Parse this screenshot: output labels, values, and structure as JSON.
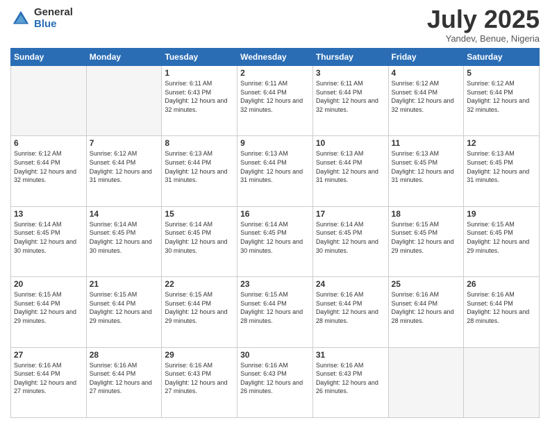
{
  "header": {
    "logo_general": "General",
    "logo_blue": "Blue",
    "title": "July 2025",
    "location": "Yandev, Benue, Nigeria"
  },
  "days_of_week": [
    "Sunday",
    "Monday",
    "Tuesday",
    "Wednesday",
    "Thursday",
    "Friday",
    "Saturday"
  ],
  "weeks": [
    [
      {
        "day": "",
        "empty": true
      },
      {
        "day": "",
        "empty": true
      },
      {
        "day": "1",
        "sunrise": "6:11 AM",
        "sunset": "6:43 PM",
        "daylight": "12 hours and 32 minutes."
      },
      {
        "day": "2",
        "sunrise": "6:11 AM",
        "sunset": "6:44 PM",
        "daylight": "12 hours and 32 minutes."
      },
      {
        "day": "3",
        "sunrise": "6:11 AM",
        "sunset": "6:44 PM",
        "daylight": "12 hours and 32 minutes."
      },
      {
        "day": "4",
        "sunrise": "6:12 AM",
        "sunset": "6:44 PM",
        "daylight": "12 hours and 32 minutes."
      },
      {
        "day": "5",
        "sunrise": "6:12 AM",
        "sunset": "6:44 PM",
        "daylight": "12 hours and 32 minutes."
      }
    ],
    [
      {
        "day": "6",
        "sunrise": "6:12 AM",
        "sunset": "6:44 PM",
        "daylight": "12 hours and 32 minutes."
      },
      {
        "day": "7",
        "sunrise": "6:12 AM",
        "sunset": "6:44 PM",
        "daylight": "12 hours and 31 minutes."
      },
      {
        "day": "8",
        "sunrise": "6:13 AM",
        "sunset": "6:44 PM",
        "daylight": "12 hours and 31 minutes."
      },
      {
        "day": "9",
        "sunrise": "6:13 AM",
        "sunset": "6:44 PM",
        "daylight": "12 hours and 31 minutes."
      },
      {
        "day": "10",
        "sunrise": "6:13 AM",
        "sunset": "6:44 PM",
        "daylight": "12 hours and 31 minutes."
      },
      {
        "day": "11",
        "sunrise": "6:13 AM",
        "sunset": "6:45 PM",
        "daylight": "12 hours and 31 minutes."
      },
      {
        "day": "12",
        "sunrise": "6:13 AM",
        "sunset": "6:45 PM",
        "daylight": "12 hours and 31 minutes."
      }
    ],
    [
      {
        "day": "13",
        "sunrise": "6:14 AM",
        "sunset": "6:45 PM",
        "daylight": "12 hours and 30 minutes."
      },
      {
        "day": "14",
        "sunrise": "6:14 AM",
        "sunset": "6:45 PM",
        "daylight": "12 hours and 30 minutes."
      },
      {
        "day": "15",
        "sunrise": "6:14 AM",
        "sunset": "6:45 PM",
        "daylight": "12 hours and 30 minutes."
      },
      {
        "day": "16",
        "sunrise": "6:14 AM",
        "sunset": "6:45 PM",
        "daylight": "12 hours and 30 minutes."
      },
      {
        "day": "17",
        "sunrise": "6:14 AM",
        "sunset": "6:45 PM",
        "daylight": "12 hours and 30 minutes."
      },
      {
        "day": "18",
        "sunrise": "6:15 AM",
        "sunset": "6:45 PM",
        "daylight": "12 hours and 29 minutes."
      },
      {
        "day": "19",
        "sunrise": "6:15 AM",
        "sunset": "6:45 PM",
        "daylight": "12 hours and 29 minutes."
      }
    ],
    [
      {
        "day": "20",
        "sunrise": "6:15 AM",
        "sunset": "6:44 PM",
        "daylight": "12 hours and 29 minutes."
      },
      {
        "day": "21",
        "sunrise": "6:15 AM",
        "sunset": "6:44 PM",
        "daylight": "12 hours and 29 minutes."
      },
      {
        "day": "22",
        "sunrise": "6:15 AM",
        "sunset": "6:44 PM",
        "daylight": "12 hours and 29 minutes."
      },
      {
        "day": "23",
        "sunrise": "6:15 AM",
        "sunset": "6:44 PM",
        "daylight": "12 hours and 28 minutes."
      },
      {
        "day": "24",
        "sunrise": "6:16 AM",
        "sunset": "6:44 PM",
        "daylight": "12 hours and 28 minutes."
      },
      {
        "day": "25",
        "sunrise": "6:16 AM",
        "sunset": "6:44 PM",
        "daylight": "12 hours and 28 minutes."
      },
      {
        "day": "26",
        "sunrise": "6:16 AM",
        "sunset": "6:44 PM",
        "daylight": "12 hours and 28 minutes."
      }
    ],
    [
      {
        "day": "27",
        "sunrise": "6:16 AM",
        "sunset": "6:44 PM",
        "daylight": "12 hours and 27 minutes."
      },
      {
        "day": "28",
        "sunrise": "6:16 AM",
        "sunset": "6:44 PM",
        "daylight": "12 hours and 27 minutes."
      },
      {
        "day": "29",
        "sunrise": "6:16 AM",
        "sunset": "6:43 PM",
        "daylight": "12 hours and 27 minutes."
      },
      {
        "day": "30",
        "sunrise": "6:16 AM",
        "sunset": "6:43 PM",
        "daylight": "12 hours and 26 minutes."
      },
      {
        "day": "31",
        "sunrise": "6:16 AM",
        "sunset": "6:43 PM",
        "daylight": "12 hours and 26 minutes."
      },
      {
        "day": "",
        "empty": true
      },
      {
        "day": "",
        "empty": true
      }
    ]
  ]
}
